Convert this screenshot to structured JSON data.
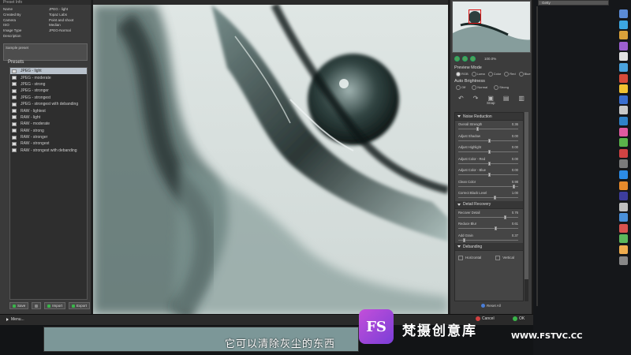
{
  "left_panel": {
    "header": "Preset Info",
    "info": [
      {
        "key": "Name",
        "value": "JPEG - light"
      },
      {
        "key": "Created By",
        "value": "Topaz Labs"
      },
      {
        "key": "Camera",
        "value": "Point and shoot"
      },
      {
        "key": "ISO",
        "value": "Median"
      },
      {
        "key": "Image Type",
        "value": "JPEG-Normal"
      },
      {
        "key": "Description",
        "value": ""
      }
    ],
    "description_text": "Sample preset",
    "presets_title": "Presets",
    "presets": [
      "JPEG - light",
      "JPEG - moderate",
      "JPEG - strong",
      "JPEG - stronger",
      "JPEG - strongest",
      "JPEG - strongest with debanding",
      "RAW - lightest",
      "RAW - light",
      "RAW - moderate",
      "RAW - strong",
      "RAW - stronger",
      "RAW - strongest",
      "RAW - strongest with debanding"
    ],
    "selected_preset_index": 0,
    "buttons": {
      "save": "Save",
      "import": "Import",
      "export": "Export"
    }
  },
  "right_panel": {
    "zoom_label": "100.0%",
    "preview_mode_title": "Preview Mode",
    "preview_modes": [
      "RGB",
      "Luma",
      "Color",
      "Red",
      "Blue"
    ],
    "auto_brightness_title": "Auto Brightness",
    "auto_brightness_options": [
      "Off",
      "Normal",
      "Strong"
    ],
    "snap_label": "Snap",
    "noise_reduction": {
      "title": "Noise Reduction",
      "sliders": [
        {
          "label": "Overall Strength",
          "value": "0.36",
          "pos": 0.32
        },
        {
          "label": "Adjust Shadow",
          "value": "0.00",
          "pos": 0.5
        },
        {
          "label": "Adjust Highlight",
          "value": "0.00",
          "pos": 0.5
        },
        {
          "label": "Adjust Color - Red",
          "value": "0.00",
          "pos": 0.5
        },
        {
          "label": "Adjust Color - Blue",
          "value": "0.00",
          "pos": 0.5
        },
        {
          "label": "Clean Color",
          "value": "0.98",
          "pos": 0.9
        },
        {
          "label": "Correct Black Level",
          "value": "1.00",
          "pos": 0.6
        }
      ]
    },
    "detail_recovery": {
      "title": "Detail Recovery",
      "sliders": [
        {
          "label": "Recover Detail",
          "value": "0.76",
          "pos": 0.76
        },
        {
          "label": "Reduce Blur",
          "value": "0.61",
          "pos": 0.61
        },
        {
          "label": "Add Grain",
          "value": "0.37",
          "pos": 0.1
        }
      ]
    },
    "debanding": {
      "title": "Debanding",
      "options": [
        "Horizontal",
        "Vertical"
      ]
    },
    "reset_label": "Reset All"
  },
  "bottom_bar": {
    "menu_label": "Menu...",
    "cancel_label": "Cancel",
    "ok_label": "OK"
  },
  "desktop": {
    "top_label": "Getty"
  },
  "overlay": {
    "subtitle": "它可以清除灰尘的东西",
    "watermark_logo": "FS",
    "watermark_text": "梵摄创意库",
    "watermark_url": "WWW.FSTVC.CC"
  },
  "colors": {
    "panel": "#3a3a3a",
    "accent_green": "#3ab54a",
    "cancel_red": "#d24141",
    "selection": "#b9c2cc"
  }
}
